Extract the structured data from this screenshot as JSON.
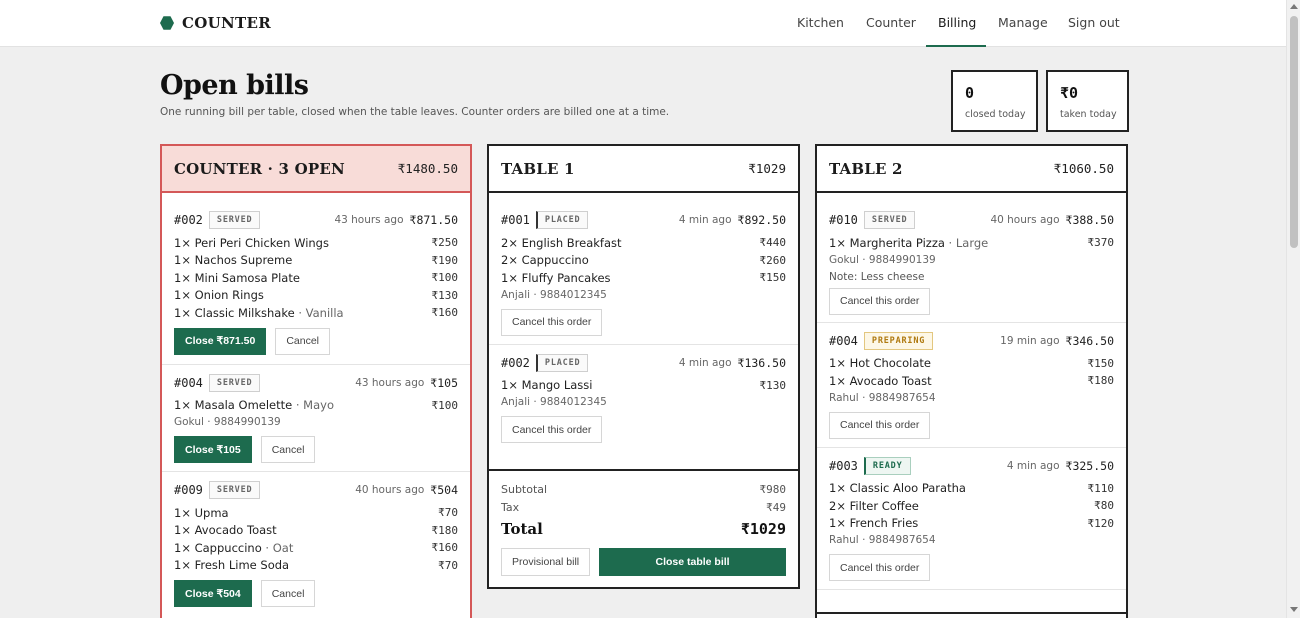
{
  "app": {
    "brand": "COUNTER"
  },
  "nav": [
    {
      "label": "Kitchen",
      "active": false
    },
    {
      "label": "Counter",
      "active": false
    },
    {
      "label": "Billing",
      "active": true
    },
    {
      "label": "Manage",
      "active": false
    },
    {
      "label": "Sign out",
      "active": false
    }
  ],
  "page": {
    "title": "Open bills",
    "subtitle": "One running bill per table, closed when the table leaves. Counter orders are billed one at a time."
  },
  "stats": [
    {
      "value": "0",
      "label": "closed today"
    },
    {
      "value": "₹0",
      "label": "taken today"
    }
  ],
  "counter": {
    "title": "COUNTER · 3 OPEN",
    "total": "₹1480.50",
    "orders": [
      {
        "id": "#002",
        "status": "SERVED",
        "time": "43 hours ago",
        "amount": "₹871.50",
        "items": [
          {
            "name": "1× Peri Peri Chicken Wings",
            "mod": "",
            "price": "₹250"
          },
          {
            "name": "1× Nachos Supreme",
            "mod": "",
            "price": "₹190"
          },
          {
            "name": "1× Mini Samosa Plate",
            "mod": "",
            "price": "₹100"
          },
          {
            "name": "1× Onion Rings",
            "mod": "",
            "price": "₹130"
          },
          {
            "name": "1× Classic Milkshake",
            "mod": " · Vanilla",
            "price": "₹160"
          }
        ],
        "customer": "",
        "close_label": "Close ₹871.50",
        "cancel_label": "Cancel"
      },
      {
        "id": "#004",
        "status": "SERVED",
        "time": "43 hours ago",
        "amount": "₹105",
        "items": [
          {
            "name": "1× Masala Omelette",
            "mod": " · Mayo",
            "price": "₹100"
          }
        ],
        "customer": "Gokul · 9884990139",
        "close_label": "Close ₹105",
        "cancel_label": "Cancel"
      },
      {
        "id": "#009",
        "status": "SERVED",
        "time": "40 hours ago",
        "amount": "₹504",
        "items": [
          {
            "name": "1× Upma",
            "mod": "",
            "price": "₹70"
          },
          {
            "name": "1× Avocado Toast",
            "mod": "",
            "price": "₹180"
          },
          {
            "name": "1× Cappuccino",
            "mod": " · Oat",
            "price": "₹160"
          },
          {
            "name": "1× Fresh Lime Soda",
            "mod": "",
            "price": "₹70"
          }
        ],
        "customer": "",
        "close_label": "Close ₹504",
        "cancel_label": "Cancel"
      }
    ]
  },
  "table1": {
    "title": "TABLE 1",
    "total": "₹1029",
    "orders": [
      {
        "id": "#001",
        "status": "PLACED",
        "time": "4 min ago",
        "amount": "₹892.50",
        "items": [
          {
            "name": "2× English Breakfast",
            "mod": "",
            "price": "₹440"
          },
          {
            "name": "2× Cappuccino",
            "mod": "",
            "price": "₹260"
          },
          {
            "name": "1× Fluffy Pancakes",
            "mod": "",
            "price": "₹150"
          }
        ],
        "customer": "Anjali · 9884012345",
        "cancel_label": "Cancel this order"
      },
      {
        "id": "#002",
        "status": "PLACED",
        "time": "4 min ago",
        "amount": "₹136.50",
        "items": [
          {
            "name": "1× Mango Lassi",
            "mod": "",
            "price": "₹130"
          }
        ],
        "customer": "Anjali · 9884012345",
        "cancel_label": "Cancel this order"
      }
    ],
    "footer": {
      "subtotal_label": "Subtotal",
      "subtotal": "₹980",
      "tax_label": "Tax",
      "tax": "₹49",
      "total_label": "Total",
      "total": "₹1029",
      "provisional_label": "Provisional bill",
      "close_label": "Close table bill"
    }
  },
  "table2": {
    "title": "TABLE 2",
    "total": "₹1060.50",
    "orders": [
      {
        "id": "#010",
        "status": "SERVED",
        "time": "40 hours ago",
        "amount": "₹388.50",
        "items": [
          {
            "name": "1× Margherita Pizza",
            "mod": " · Large",
            "price": "₹370"
          }
        ],
        "customer": "Gokul · 9884990139",
        "note": "Note: Less cheese",
        "cancel_label": "Cancel this order"
      },
      {
        "id": "#004",
        "status": "PREPARING",
        "time": "19 min ago",
        "amount": "₹346.50",
        "items": [
          {
            "name": "1× Hot Chocolate",
            "mod": "",
            "price": "₹150"
          },
          {
            "name": "1× Avocado Toast",
            "mod": "",
            "price": "₹180"
          }
        ],
        "customer": "Rahul · 9884987654",
        "cancel_label": "Cancel this order"
      },
      {
        "id": "#003",
        "status": "READY",
        "time": "4 min ago",
        "amount": "₹325.50",
        "items": [
          {
            "name": "1× Classic Aloo Paratha",
            "mod": "",
            "price": "₹110"
          },
          {
            "name": "2× Filter Coffee",
            "mod": "",
            "price": "₹80"
          },
          {
            "name": "1× French Fries",
            "mod": "",
            "price": "₹120"
          }
        ],
        "customer": "Rahul · 9884987654",
        "cancel_label": "Cancel this order"
      }
    ]
  },
  "colors": {
    "accent": "#1d6b4e",
    "counter_header_bg": "#f8dcd8",
    "counter_border": "#d45858",
    "preparing": "#b07a10"
  }
}
